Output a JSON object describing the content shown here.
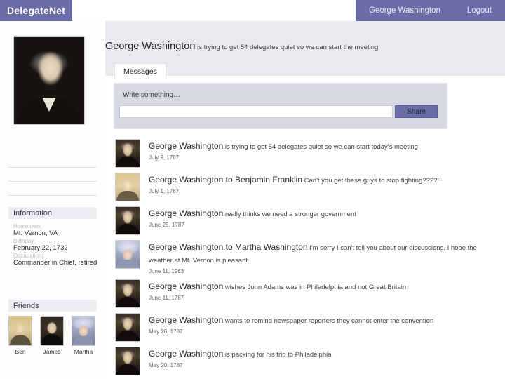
{
  "colors": {
    "brand_purple": "#6b6ba6",
    "band_gray": "#e9eaee",
    "composer_lavender": "#d6d8e4",
    "section_head_gray": "#edeef1"
  },
  "topbar": {
    "brand": "DelegateNet",
    "user_link": "George Washington",
    "logout_link": "Logout"
  },
  "status": {
    "name": "George Washington",
    "text": " is trying to get 54 delegates quiet so we can start the meeting"
  },
  "tabs": [
    {
      "label": "Messages",
      "active": true
    }
  ],
  "composer": {
    "label": "Write something…",
    "input_value": "",
    "input_placeholder": "",
    "share_label": "Share"
  },
  "sidebar": {
    "profile_photo_alt": "George Washington portrait",
    "information": {
      "heading": "Information",
      "fields": [
        {
          "label": "Hometown:",
          "value": "Mt. Vernon, VA"
        },
        {
          "label": "Birthday:",
          "value": "February 22, 1732"
        },
        {
          "label": "Occupation:",
          "value": "Commander in Chief, retired"
        }
      ]
    },
    "friends": {
      "heading": "Friends",
      "items": [
        {
          "name": "Ben",
          "portrait": "ben"
        },
        {
          "name": "James",
          "portrait": "james"
        },
        {
          "name": "Martha",
          "portrait": "martha"
        }
      ]
    }
  },
  "feed": {
    "posts": [
      {
        "author": "George Washington",
        "text": " is trying to get 54 delegates quiet so we can start today's meeting",
        "date": "July 9, 1787",
        "avatar": "gw"
      },
      {
        "author": "George Washington to Benjamin Franklin",
        "text": " Can't you get these guys to stop fighting????!!",
        "date": "July 1, 1787",
        "avatar": "bf"
      },
      {
        "author": "George Washington",
        "text": " really thinks we need a stronger government",
        "date": "June 25, 1787",
        "avatar": "gw"
      },
      {
        "author": "George Washington to Martha Washington",
        "text": " I'm sorry I can't tell you about our discussions. I hope the weather at Mt. Vernon is pleasant.",
        "date": "June 11, 1963",
        "avatar": "mw"
      },
      {
        "author": "George Washington",
        "text": " wishes John Adams was in Philadelphia and not Great Britain",
        "date": "June 11, 1787",
        "avatar": "gw"
      },
      {
        "author": "George Washington",
        "text": " wants to remind newspaper reporters they cannot enter the convention",
        "date": "May 26, 1787",
        "avatar": "gw"
      },
      {
        "author": "George Washington",
        "text": " is packing for his trip to Philadelphia",
        "date": "May 20, 1787",
        "avatar": "gw"
      }
    ]
  }
}
